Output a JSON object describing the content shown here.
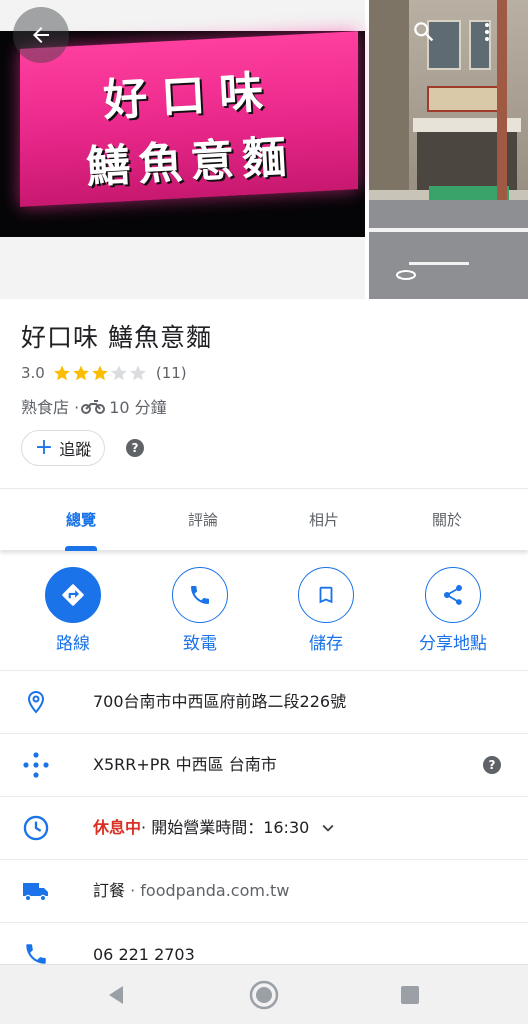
{
  "photos": {
    "sign_line1": "好口味",
    "sign_line2": "鱔魚意麵"
  },
  "place": {
    "name": "好口味 鱔魚意麵",
    "rating": "3.0",
    "rating_value": 3.0,
    "rating_max": 5,
    "review_count": "(11)",
    "category": "熟食店 · ",
    "travel_time": "10 分鐘"
  },
  "follow": {
    "label": "追蹤"
  },
  "tabs": [
    {
      "label": "總覽",
      "active": true
    },
    {
      "label": "評論",
      "active": false
    },
    {
      "label": "相片",
      "active": false
    },
    {
      "label": "關於",
      "active": false
    }
  ],
  "actions": [
    {
      "label": "路線",
      "icon": "directions-icon"
    },
    {
      "label": "致電",
      "icon": "phone-icon"
    },
    {
      "label": "儲存",
      "icon": "bookmark-icon"
    },
    {
      "label": "分享地點",
      "icon": "share-icon"
    }
  ],
  "info": {
    "address": "700台南市中西區府前路二段226號",
    "plus_code": "X5RR+PR 中西區 台南市",
    "hours_status": "休息中",
    "hours_detail": " · 開始營業時間：16:30",
    "order_label": "訂餐",
    "order_site": " · foodpanda.com.tw",
    "phone": "06 221 2703"
  },
  "colors": {
    "accent": "#1a73e8",
    "closed": "#d93025",
    "star": "#fbbc04",
    "star_empty": "#dadce0"
  }
}
